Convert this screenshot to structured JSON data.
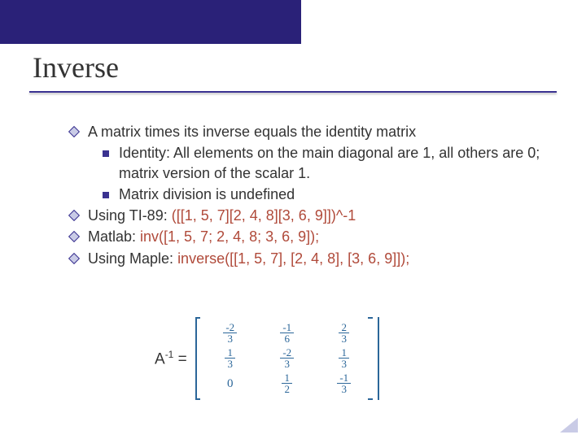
{
  "title": "Inverse",
  "bullets": {
    "b1": "A matrix times its inverse equals the identity matrix",
    "b1a": "Identity: All elements on the main diagonal are 1, all others are 0; matrix version of the scalar 1.",
    "b1b": "Matrix division is undefined",
    "b2_pre": "Using TI-89: ",
    "b2_hl": "([[1, 5, 7][2, 4, 8][3, 6, 9]])^-1",
    "b3_pre": "Matlab: ",
    "b3_hl": "inv([1, 5, 7; 2, 4, 8; 3, 6, 9]);",
    "b4_pre": "Using Maple: ",
    "b4_hl": "inverse([[1, 5, 7], [2, 4, 8], [3, 6, 9]]);"
  },
  "matrix_label_base": "A",
  "matrix_label_sup": "-1",
  "matrix_label_eq": " =",
  "inverse_matrix": [
    [
      {
        "n": "-2",
        "d": "3"
      },
      {
        "n": "-1",
        "d": "6"
      },
      {
        "n": "2",
        "d": "3"
      }
    ],
    [
      {
        "n": "1",
        "d": "3"
      },
      {
        "n": "-2",
        "d": "3"
      },
      {
        "n": "1",
        "d": "3"
      }
    ],
    [
      {
        "zero": "0"
      },
      {
        "n": "1",
        "d": "2"
      },
      {
        "n": "-1",
        "d": "3"
      }
    ]
  ]
}
